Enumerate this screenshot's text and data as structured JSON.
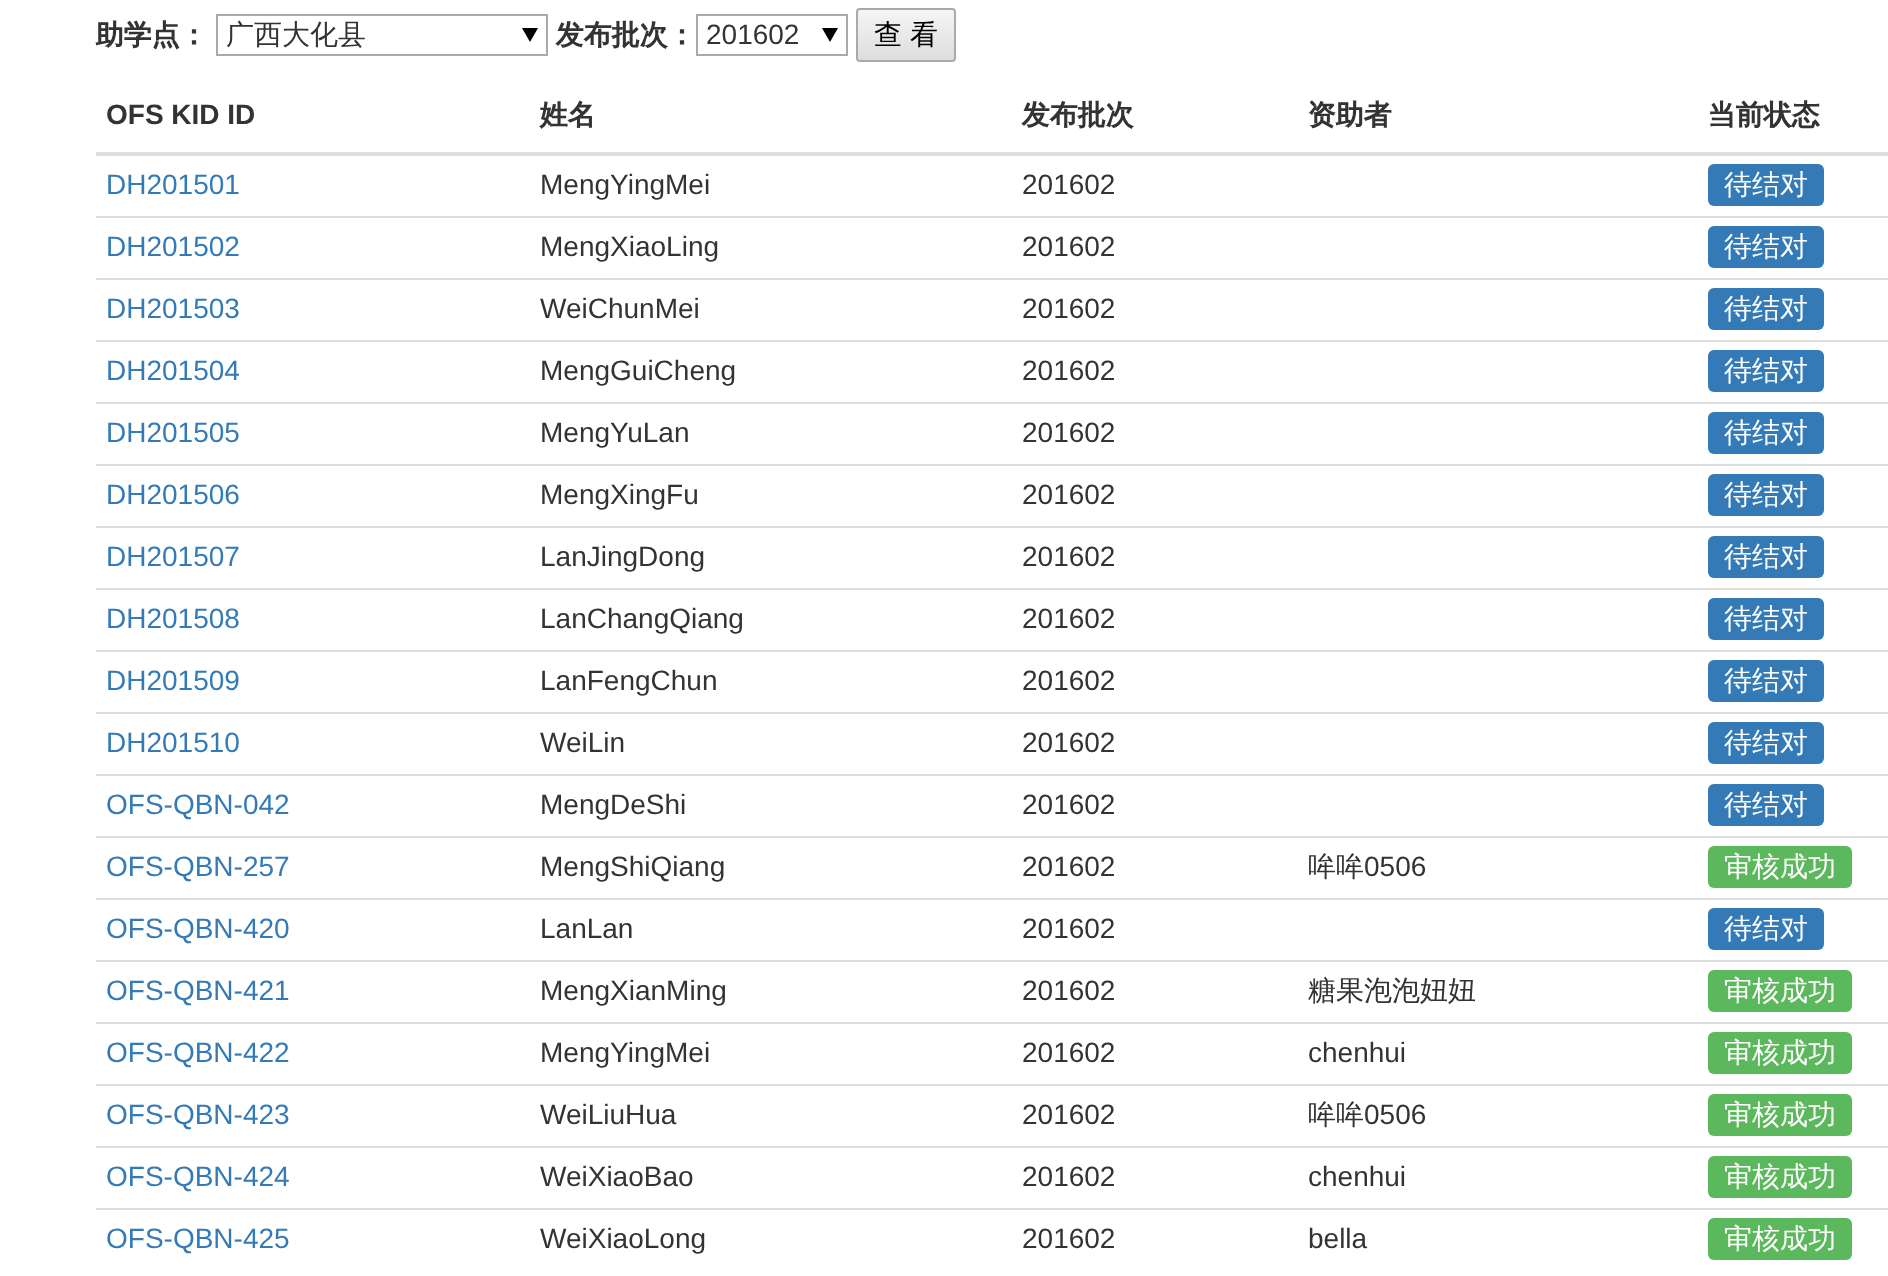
{
  "filter": {
    "site_label": "助学点：",
    "site_value": "广西大化县",
    "batch_label": "发布批次：",
    "batch_value": "201602",
    "view_button": "查 看"
  },
  "table": {
    "columns": [
      "OFS KID ID",
      "姓名",
      "发布批次",
      "资助者",
      "当前状态"
    ],
    "rows": [
      {
        "id": "DH201501",
        "name": "MengYingMei",
        "batch": "201602",
        "sponsor": "",
        "status": "待结对",
        "kind": "pending"
      },
      {
        "id": "DH201502",
        "name": "MengXiaoLing",
        "batch": "201602",
        "sponsor": "",
        "status": "待结对",
        "kind": "pending"
      },
      {
        "id": "DH201503",
        "name": "WeiChunMei",
        "batch": "201602",
        "sponsor": "",
        "status": "待结对",
        "kind": "pending"
      },
      {
        "id": "DH201504",
        "name": "MengGuiCheng",
        "batch": "201602",
        "sponsor": "",
        "status": "待结对",
        "kind": "pending"
      },
      {
        "id": "DH201505",
        "name": "MengYuLan",
        "batch": "201602",
        "sponsor": "",
        "status": "待结对",
        "kind": "pending"
      },
      {
        "id": "DH201506",
        "name": "MengXingFu",
        "batch": "201602",
        "sponsor": "",
        "status": "待结对",
        "kind": "pending"
      },
      {
        "id": "DH201507",
        "name": "LanJingDong",
        "batch": "201602",
        "sponsor": "",
        "status": "待结对",
        "kind": "pending"
      },
      {
        "id": "DH201508",
        "name": "LanChangQiang",
        "batch": "201602",
        "sponsor": "",
        "status": "待结对",
        "kind": "pending"
      },
      {
        "id": "DH201509",
        "name": "LanFengChun",
        "batch": "201602",
        "sponsor": "",
        "status": "待结对",
        "kind": "pending"
      },
      {
        "id": "DH201510",
        "name": "WeiLin",
        "batch": "201602",
        "sponsor": "",
        "status": "待结对",
        "kind": "pending"
      },
      {
        "id": "OFS-QBN-042",
        "name": "MengDeShi",
        "batch": "201602",
        "sponsor": "",
        "status": "待结对",
        "kind": "pending"
      },
      {
        "id": "OFS-QBN-257",
        "name": "MengShiQiang",
        "batch": "201602",
        "sponsor": "哞哞0506",
        "status": "审核成功",
        "kind": "approved"
      },
      {
        "id": "OFS-QBN-420",
        "name": "LanLan",
        "batch": "201602",
        "sponsor": "",
        "status": "待结对",
        "kind": "pending"
      },
      {
        "id": "OFS-QBN-421",
        "name": "MengXianMing",
        "batch": "201602",
        "sponsor": "糖果泡泡妞妞",
        "status": "审核成功",
        "kind": "approved"
      },
      {
        "id": "OFS-QBN-422",
        "name": "MengYingMei",
        "batch": "201602",
        "sponsor": "chenhui",
        "status": "审核成功",
        "kind": "approved"
      },
      {
        "id": "OFS-QBN-423",
        "name": "WeiLiuHua",
        "batch": "201602",
        "sponsor": "哞哞0506",
        "status": "审核成功",
        "kind": "approved"
      },
      {
        "id": "OFS-QBN-424",
        "name": "WeiXiaoBao",
        "batch": "201602",
        "sponsor": "chenhui",
        "status": "审核成功",
        "kind": "approved"
      },
      {
        "id": "OFS-QBN-425",
        "name": "WeiXiaoLong",
        "batch": "201602",
        "sponsor": "bella",
        "status": "审核成功",
        "kind": "approved"
      }
    ]
  }
}
